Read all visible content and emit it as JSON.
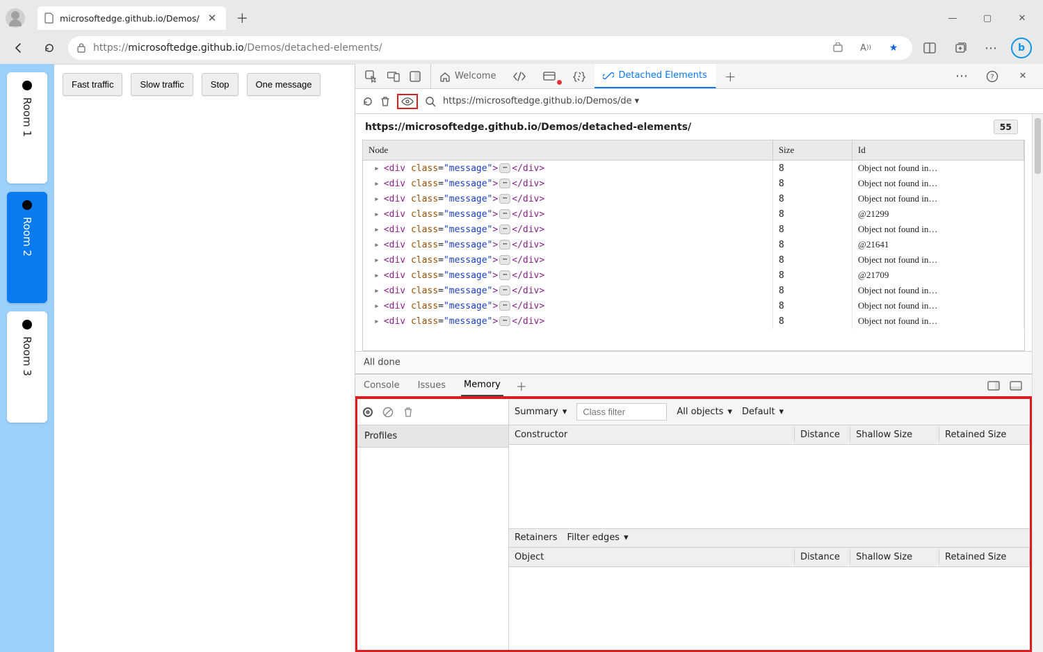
{
  "browser": {
    "tab_title": "microsoftedge.github.io/Demos/",
    "url_before_path": "https://",
    "url_host": "microsoftedge.github.io",
    "url_path": "/Demos/detached-elements/",
    "win": {
      "minimize": "—",
      "maximize": "▢",
      "close": "✕"
    }
  },
  "page": {
    "rooms": [
      {
        "label": "Room 1",
        "selected": false
      },
      {
        "label": "Room 2",
        "selected": true
      },
      {
        "label": "Room 3",
        "selected": false
      }
    ],
    "buttons": {
      "fast": "Fast traffic",
      "slow": "Slow traffic",
      "stop": "Stop",
      "one": "One message"
    }
  },
  "devtools": {
    "top_tabs": {
      "welcome": "Welcome",
      "detached": "Detached Elements"
    },
    "frame_url_short": "https://microsoftedge.github.io/Demos/de",
    "page_heading": "https://microsoftedge.github.io/Demos/detached-elements/",
    "count": "55",
    "columns": {
      "node": "Node",
      "size": "Size",
      "id": "Id"
    },
    "node_markup": {
      "open": "<div class=\"message\">",
      "close": "</div>"
    },
    "rows": [
      {
        "size": "8",
        "id": "Object not found in…"
      },
      {
        "size": "8",
        "id": "Object not found in…"
      },
      {
        "size": "8",
        "id": "Object not found in…"
      },
      {
        "size": "8",
        "id": "@21299"
      },
      {
        "size": "8",
        "id": "Object not found in…"
      },
      {
        "size": "8",
        "id": "@21641"
      },
      {
        "size": "8",
        "id": "Object not found in…"
      },
      {
        "size": "8",
        "id": "@21709"
      },
      {
        "size": "8",
        "id": "Object not found in…"
      },
      {
        "size": "8",
        "id": "Object not found in…"
      },
      {
        "size": "8",
        "id": "Object not found in…"
      }
    ],
    "status": "All done"
  },
  "drawer": {
    "tabs": {
      "console": "Console",
      "issues": "Issues",
      "memory": "Memory"
    },
    "profiles_sidebar": "Profiles",
    "memory": {
      "view": "Summary",
      "class_filter_placeholder": "Class filter",
      "scope": "All objects",
      "default": "Default",
      "constructor_col": "Constructor",
      "distance_col": "Distance",
      "shallow_col": "Shallow Size",
      "retained_col": "Retained Size",
      "retainers": "Retainers",
      "filter_edges": "Filter edges",
      "object_col": "Object"
    }
  }
}
